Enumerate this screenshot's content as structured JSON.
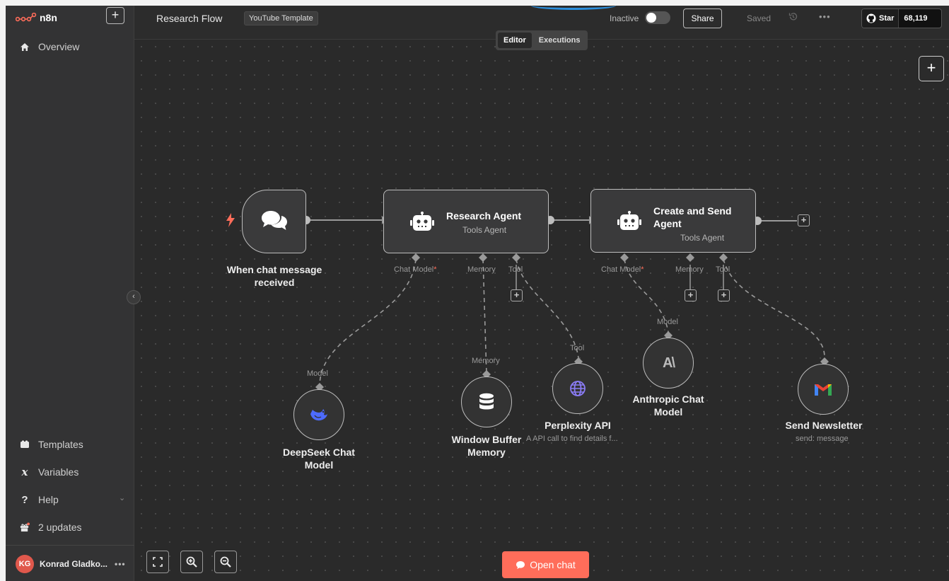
{
  "app": {
    "brand": "n8n"
  },
  "sidebar": {
    "add_label": "+",
    "items": [
      {
        "label": "Overview",
        "icon": "home-icon"
      },
      {
        "label": "Templates",
        "icon": "templates-icon"
      },
      {
        "label": "Variables",
        "icon": "variables-icon"
      },
      {
        "label": "Help",
        "icon": "help-icon"
      },
      {
        "label": "2 updates",
        "icon": "gift-icon"
      }
    ],
    "user": {
      "initials": "KG",
      "name": "Konrad Gladko...",
      "more": "•••"
    }
  },
  "header": {
    "workflow_name": "Research Flow",
    "tag": "YouTube Template",
    "status_label": "Inactive",
    "share_label": "Share",
    "saved_label": "Saved",
    "more_label": "•••",
    "github": {
      "star_label": "Star",
      "count": "68,119"
    }
  },
  "mode_tabs": {
    "editor": "Editor",
    "executions": "Executions"
  },
  "canvas": {
    "nodes": {
      "trigger": {
        "label": "When chat message received"
      },
      "research_agent": {
        "title": "Research Agent",
        "subtitle": "Tools Agent"
      },
      "send_agent": {
        "title": "Create and Send Agent",
        "subtitle": "Tools Agent"
      },
      "deepseek": {
        "label": "DeepSeek Chat Model",
        "port": "Model"
      },
      "window_memory": {
        "label": "Window Buffer Memory",
        "port": "Memory"
      },
      "perplexity": {
        "label": "Perplexity API",
        "sub": "A API call to find details f...",
        "port": "Tool"
      },
      "anthropic": {
        "label": "Anthropic Chat Model",
        "port": "Model"
      },
      "send_newsletter": {
        "label": "Send Newsletter",
        "sub": "send: message"
      }
    },
    "ports": {
      "chat_model": "Chat Model",
      "required": "*",
      "memory": "Memory",
      "tool": "Tool"
    },
    "open_chat_label": "Open chat",
    "colors": {
      "accent": "#ff6d5a",
      "canvas": "#2a2a2a",
      "node": "#3a3a3b"
    }
  }
}
